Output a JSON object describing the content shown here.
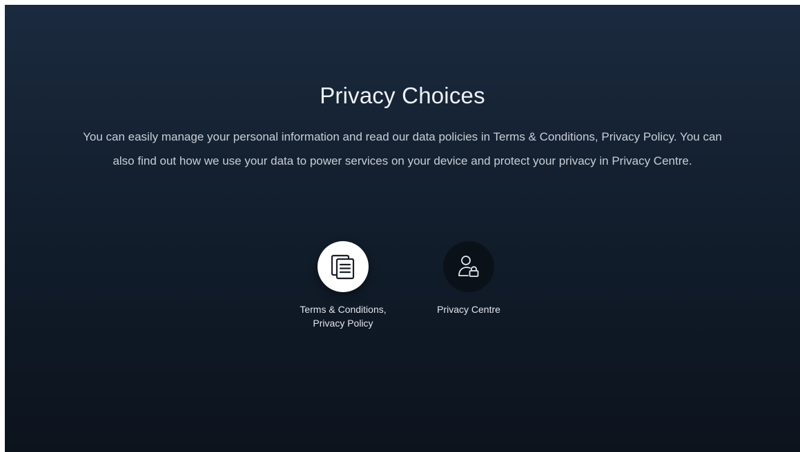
{
  "page": {
    "title": "Privacy Choices",
    "description": "You can easily manage your personal information and read our data policies in Terms & Conditions, Privacy Policy. You can also find out how we use your data to power services on your device and protect your privacy in Privacy Centre."
  },
  "options": [
    {
      "label_line1": "Terms & Conditions,",
      "label_line2": "Privacy Policy",
      "icon": "documents-icon",
      "focused": true
    },
    {
      "label_line1": "Privacy Centre",
      "icon": "person-lock-icon",
      "focused": false
    }
  ],
  "colors": {
    "background_top": "#1b2a3f",
    "background_bottom": "#0c131d",
    "focused_circle": "#ffffff",
    "normal_circle": "#0b1118",
    "text": "#e6e9ee"
  }
}
